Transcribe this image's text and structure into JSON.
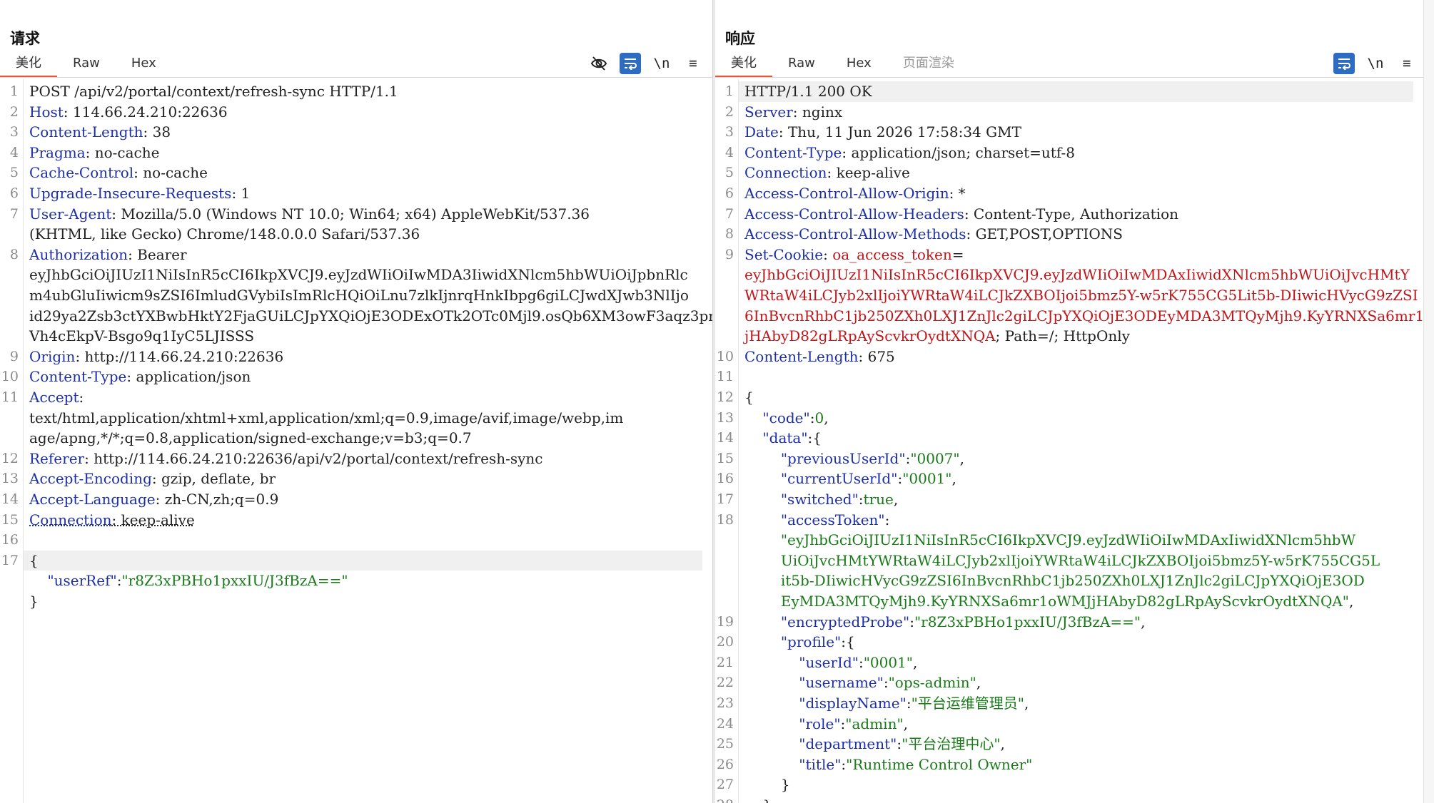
{
  "layout_buttons": [
    "split-columns-icon",
    "split-rows-icon",
    "single-pane-icon"
  ],
  "request": {
    "title": "请求",
    "tabs": [
      "美化",
      "Raw",
      "Hex"
    ],
    "toolbar": {
      "newline_label": "\\n",
      "menu_label": "≡"
    },
    "lines": [
      {
        "n": "1",
        "parts": [
          {
            "t": "POST /api/v2/portal/context/refresh-sync HTTP/1.1",
            "c": ""
          }
        ]
      },
      {
        "n": "2",
        "parts": [
          {
            "t": "Host",
            "c": "hdr-name"
          },
          {
            "t": ": 114.66.24.210:22636",
            "c": ""
          }
        ]
      },
      {
        "n": "3",
        "parts": [
          {
            "t": "Content-Length",
            "c": "hdr-name"
          },
          {
            "t": ": 38",
            "c": ""
          }
        ]
      },
      {
        "n": "4",
        "parts": [
          {
            "t": "Pragma",
            "c": "hdr-name"
          },
          {
            "t": ": no-cache",
            "c": ""
          }
        ]
      },
      {
        "n": "5",
        "parts": [
          {
            "t": "Cache-Control",
            "c": "hdr-name"
          },
          {
            "t": ": no-cache",
            "c": ""
          }
        ]
      },
      {
        "n": "6",
        "parts": [
          {
            "t": "Upgrade-Insecure-Requests",
            "c": "hdr-name"
          },
          {
            "t": ": 1",
            "c": ""
          }
        ]
      },
      {
        "n": "7",
        "parts": [
          {
            "t": "User-Agent",
            "c": "hdr-name"
          },
          {
            "t": ": Mozilla/5.0 (Windows NT 10.0; Win64; x64) AppleWebKit/537.36",
            "c": ""
          }
        ]
      },
      {
        "n": "",
        "parts": [
          {
            "t": "(KHTML, like Gecko) Chrome/148.0.0.0 Safari/537.36",
            "c": ""
          }
        ]
      },
      {
        "n": "8",
        "parts": [
          {
            "t": "Authorization",
            "c": "hdr-name"
          },
          {
            "t": ": Bearer",
            "c": ""
          }
        ]
      },
      {
        "n": "",
        "parts": [
          {
            "t": "eyJhbGciOiJIUzI1NiIsInR5cCI6IkpXVCJ9.eyJzdWIiOiIwMDA3IiwidXNlcm5hbWUiOiJpbnRlc",
            "c": ""
          }
        ]
      },
      {
        "n": "",
        "parts": [
          {
            "t": "m4ubGluIiwicm9sZSI6ImludGVybiIsImRlcHQiOiLnu7zlkIjnrqHnkIbpg6giLCJwdXJwb3NlIjo",
            "c": ""
          }
        ]
      },
      {
        "n": "",
        "parts": [
          {
            "t": "id29ya2Zsb3ctYXBwbHktY2FjaGUiLCJpYXQiOjE3ODExOTk2OTc0Mjl9.osQb6XM3owF3aqz3pnfi",
            "c": ""
          }
        ]
      },
      {
        "n": "",
        "parts": [
          {
            "t": "Vh4cEkpV-Bsgo9q1IyC5LJISSS",
            "c": ""
          }
        ]
      },
      {
        "n": "9",
        "parts": [
          {
            "t": "Origin",
            "c": "hdr-name"
          },
          {
            "t": ": http://114.66.24.210:22636",
            "c": ""
          }
        ]
      },
      {
        "n": "10",
        "parts": [
          {
            "t": "Content-Type",
            "c": "hdr-name"
          },
          {
            "t": ": application/json",
            "c": ""
          }
        ]
      },
      {
        "n": "11",
        "parts": [
          {
            "t": "Accept",
            "c": "hdr-name"
          },
          {
            "t": ":",
            "c": ""
          }
        ]
      },
      {
        "n": "",
        "parts": [
          {
            "t": "text/html,application/xhtml+xml,application/xml;q=0.9,image/avif,image/webp,im",
            "c": ""
          }
        ]
      },
      {
        "n": "",
        "parts": [
          {
            "t": "age/apng,*/*;q=0.8,application/signed-exchange;v=b3;q=0.7",
            "c": ""
          }
        ]
      },
      {
        "n": "12",
        "parts": [
          {
            "t": "Referer",
            "c": "hdr-name"
          },
          {
            "t": ": http://114.66.24.210:22636/api/v2/portal/context/refresh-sync",
            "c": ""
          }
        ]
      },
      {
        "n": "13",
        "parts": [
          {
            "t": "Accept-Encoding",
            "c": "hdr-name"
          },
          {
            "t": ": gzip, deflate, br",
            "c": ""
          }
        ]
      },
      {
        "n": "14",
        "parts": [
          {
            "t": "Accept-Language",
            "c": "hdr-name"
          },
          {
            "t": ": zh-CN,zh;q=0.9",
            "c": ""
          }
        ]
      },
      {
        "n": "15",
        "parts": [
          {
            "t": "Connection",
            "c": "hdr-name underl"
          },
          {
            "t": ": keep-alive",
            "c": "underl"
          }
        ]
      },
      {
        "n": "16",
        "parts": []
      },
      {
        "n": "17",
        "parts": [
          {
            "t": "{",
            "c": ""
          }
        ],
        "hl": true
      },
      {
        "n": "",
        "parts": [
          {
            "t": "    ",
            "c": ""
          },
          {
            "t": "\"userRef\"",
            "c": "jkey"
          },
          {
            "t": ":",
            "c": ""
          },
          {
            "t": "\"r8Z3xPBHo1pxxIU/J3fBzA==\"",
            "c": "jstr"
          }
        ]
      },
      {
        "n": "",
        "parts": [
          {
            "t": "}",
            "c": ""
          }
        ]
      }
    ]
  },
  "response": {
    "title": "响应",
    "tabs": [
      "美化",
      "Raw",
      "Hex",
      "页面渲染"
    ],
    "toolbar": {
      "newline_label": "\\n",
      "menu_label": "≡"
    },
    "lines": [
      {
        "n": "1",
        "parts": [
          {
            "t": "HTTP/1.1 200 OK",
            "c": ""
          }
        ],
        "hl": true
      },
      {
        "n": "2",
        "parts": [
          {
            "t": "Server",
            "c": "hdr-name"
          },
          {
            "t": ": nginx",
            "c": ""
          }
        ]
      },
      {
        "n": "3",
        "parts": [
          {
            "t": "Date",
            "c": "hdr-name"
          },
          {
            "t": ": Thu, 11 Jun 2026 17:58:34 GMT",
            "c": ""
          }
        ]
      },
      {
        "n": "4",
        "parts": [
          {
            "t": "Content-Type",
            "c": "hdr-name"
          },
          {
            "t": ": application/json; charset=utf-8",
            "c": ""
          }
        ]
      },
      {
        "n": "5",
        "parts": [
          {
            "t": "Connection",
            "c": "hdr-name"
          },
          {
            "t": ": keep-alive",
            "c": ""
          }
        ]
      },
      {
        "n": "6",
        "parts": [
          {
            "t": "Access-Control-Allow-Origin",
            "c": "hdr-name"
          },
          {
            "t": ": *",
            "c": ""
          }
        ]
      },
      {
        "n": "7",
        "parts": [
          {
            "t": "Access-Control-Allow-Headers",
            "c": "hdr-name"
          },
          {
            "t": ": Content-Type, Authorization",
            "c": ""
          }
        ]
      },
      {
        "n": "8",
        "parts": [
          {
            "t": "Access-Control-Allow-Methods",
            "c": "hdr-name"
          },
          {
            "t": ": GET,POST,OPTIONS",
            "c": ""
          }
        ]
      },
      {
        "n": "9",
        "parts": [
          {
            "t": "Set-Cookie",
            "c": "hdr-name"
          },
          {
            "t": ": ",
            "c": ""
          },
          {
            "t": "oa_access_token",
            "c": "cookie-val"
          },
          {
            "t": "=",
            "c": ""
          }
        ]
      },
      {
        "n": "",
        "parts": [
          {
            "t": "eyJhbGciOiJIUzI1NiIsInR5cCI6IkpXVCJ9.eyJzdWIiOiIwMDAxIiwidXNlcm5hbWUiOiJvcHMtY",
            "c": "cookie-val"
          }
        ]
      },
      {
        "n": "",
        "parts": [
          {
            "t": "WRtaW4iLCJyb2xlIjoiYWRtaW4iLCJkZXBOIjoi5bmz5Y-w5rK755CG5Lit5b-DIiwicHVycG9zZSI",
            "c": "cookie-val"
          }
        ]
      },
      {
        "n": "",
        "parts": [
          {
            "t": "6InBvcnRhbC1jb250ZXh0LXJ1ZnJlc2giLCJpYXQiOjE3ODEyMDA3MTQyMjh9.KyYRNXSa6mr1oWMJ",
            "c": "cookie-val"
          }
        ]
      },
      {
        "n": "",
        "parts": [
          {
            "t": "jHAbyD82gLRpAyScvkrOydtXNQA",
            "c": "cookie-val"
          },
          {
            "t": "; Path=/; HttpOnly",
            "c": ""
          }
        ]
      },
      {
        "n": "10",
        "parts": [
          {
            "t": "Content-Length",
            "c": "hdr-name"
          },
          {
            "t": ": 675",
            "c": ""
          }
        ]
      },
      {
        "n": "11",
        "parts": []
      },
      {
        "n": "12",
        "parts": [
          {
            "t": "{",
            "c": ""
          }
        ]
      },
      {
        "n": "13",
        "parts": [
          {
            "t": "    ",
            "c": ""
          },
          {
            "t": "\"code\"",
            "c": "jkey"
          },
          {
            "t": ":",
            "c": ""
          },
          {
            "t": "0",
            "c": "jstr"
          },
          {
            "t": ",",
            "c": ""
          }
        ]
      },
      {
        "n": "14",
        "parts": [
          {
            "t": "    ",
            "c": ""
          },
          {
            "t": "\"data\"",
            "c": "jkey"
          },
          {
            "t": ":{",
            "c": ""
          }
        ]
      },
      {
        "n": "15",
        "parts": [
          {
            "t": "        ",
            "c": ""
          },
          {
            "t": "\"previousUserId\"",
            "c": "jkey"
          },
          {
            "t": ":",
            "c": ""
          },
          {
            "t": "\"0007\"",
            "c": "jstr"
          },
          {
            "t": ",",
            "c": ""
          }
        ]
      },
      {
        "n": "16",
        "parts": [
          {
            "t": "        ",
            "c": ""
          },
          {
            "t": "\"currentUserId\"",
            "c": "jkey"
          },
          {
            "t": ":",
            "c": ""
          },
          {
            "t": "\"0001\"",
            "c": "jstr"
          },
          {
            "t": ",",
            "c": ""
          }
        ]
      },
      {
        "n": "17",
        "parts": [
          {
            "t": "        ",
            "c": ""
          },
          {
            "t": "\"switched\"",
            "c": "jkey"
          },
          {
            "t": ":",
            "c": ""
          },
          {
            "t": "true",
            "c": "jstr"
          },
          {
            "t": ",",
            "c": ""
          }
        ]
      },
      {
        "n": "18",
        "parts": [
          {
            "t": "        ",
            "c": ""
          },
          {
            "t": "\"accessToken\"",
            "c": "jkey"
          },
          {
            "t": ":",
            "c": ""
          }
        ]
      },
      {
        "n": "",
        "parts": [
          {
            "t": "        ",
            "c": ""
          },
          {
            "t": "\"eyJhbGciOiJIUzI1NiIsInR5cCI6IkpXVCJ9.eyJzdWIiOiIwMDAxIiwidXNlcm5hbW",
            "c": "jstr"
          }
        ]
      },
      {
        "n": "",
        "parts": [
          {
            "t": "        ",
            "c": ""
          },
          {
            "t": "UiOiJvcHMtYWRtaW4iLCJyb2xlIjoiYWRtaW4iLCJkZXBOIjoi5bmz5Y-w5rK755CG5L",
            "c": "jstr"
          }
        ]
      },
      {
        "n": "",
        "parts": [
          {
            "t": "        ",
            "c": ""
          },
          {
            "t": "it5b-DIiwicHVycG9zZSI6InBvcnRhbC1jb250ZXh0LXJ1ZnJlc2giLCJpYXQiOjE3OD",
            "c": "jstr"
          }
        ]
      },
      {
        "n": "",
        "parts": [
          {
            "t": "        ",
            "c": ""
          },
          {
            "t": "EyMDA3MTQyMjh9.KyYRNXSa6mr1oWMJjHAbyD82gLRpAyScvkrOydtXNQA\"",
            "c": "jstr"
          },
          {
            "t": ",",
            "c": ""
          }
        ]
      },
      {
        "n": "19",
        "parts": [
          {
            "t": "        ",
            "c": ""
          },
          {
            "t": "\"encryptedProbe\"",
            "c": "jkey"
          },
          {
            "t": ":",
            "c": ""
          },
          {
            "t": "\"r8Z3xPBHo1pxxIU/J3fBzA==\"",
            "c": "jstr"
          },
          {
            "t": ",",
            "c": ""
          }
        ]
      },
      {
        "n": "20",
        "parts": [
          {
            "t": "        ",
            "c": ""
          },
          {
            "t": "\"profile\"",
            "c": "jkey"
          },
          {
            "t": ":{",
            "c": ""
          }
        ]
      },
      {
        "n": "21",
        "parts": [
          {
            "t": "            ",
            "c": ""
          },
          {
            "t": "\"userId\"",
            "c": "jkey"
          },
          {
            "t": ":",
            "c": ""
          },
          {
            "t": "\"0001\"",
            "c": "jstr"
          },
          {
            "t": ",",
            "c": ""
          }
        ]
      },
      {
        "n": "22",
        "parts": [
          {
            "t": "            ",
            "c": ""
          },
          {
            "t": "\"username\"",
            "c": "jkey"
          },
          {
            "t": ":",
            "c": ""
          },
          {
            "t": "\"ops-admin\"",
            "c": "jstr"
          },
          {
            "t": ",",
            "c": ""
          }
        ]
      },
      {
        "n": "23",
        "parts": [
          {
            "t": "            ",
            "c": ""
          },
          {
            "t": "\"displayName\"",
            "c": "jkey"
          },
          {
            "t": ":",
            "c": ""
          },
          {
            "t": "\"平台运维管理员\"",
            "c": "jstr"
          },
          {
            "t": ",",
            "c": ""
          }
        ]
      },
      {
        "n": "24",
        "parts": [
          {
            "t": "            ",
            "c": ""
          },
          {
            "t": "\"role\"",
            "c": "jkey"
          },
          {
            "t": ":",
            "c": ""
          },
          {
            "t": "\"admin\"",
            "c": "jstr"
          },
          {
            "t": ",",
            "c": ""
          }
        ]
      },
      {
        "n": "25",
        "parts": [
          {
            "t": "            ",
            "c": ""
          },
          {
            "t": "\"department\"",
            "c": "jkey"
          },
          {
            "t": ":",
            "c": ""
          },
          {
            "t": "\"平台治理中心\"",
            "c": "jstr"
          },
          {
            "t": ",",
            "c": ""
          }
        ]
      },
      {
        "n": "26",
        "parts": [
          {
            "t": "            ",
            "c": ""
          },
          {
            "t": "\"title\"",
            "c": "jkey"
          },
          {
            "t": ":",
            "c": ""
          },
          {
            "t": "\"Runtime Control Owner\"",
            "c": "jstr"
          }
        ]
      },
      {
        "n": "27",
        "parts": [
          {
            "t": "        ",
            "c": ""
          },
          {
            "t": "}",
            "c": ""
          }
        ]
      },
      {
        "n": "28",
        "parts": [
          {
            "t": "    ",
            "c": ""
          },
          {
            "t": "}",
            "c": ""
          }
        ]
      }
    ]
  },
  "colors": {
    "accent": "#2e6cc2",
    "tab_underline": "#e8553a",
    "header_name": "#1c2fa8",
    "json_string": "#177a17",
    "cookie": "#c0161a"
  }
}
